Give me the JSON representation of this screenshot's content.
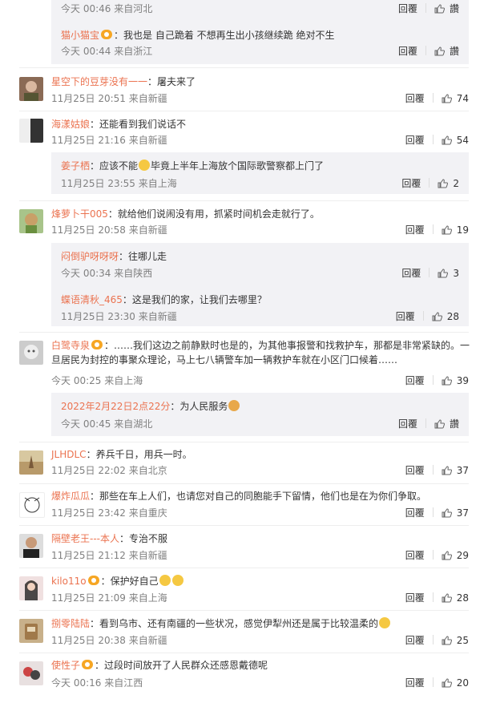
{
  "comments": [
    {
      "meta_top": "今天 00:46 来自河北",
      "reply": "回覆",
      "like": "讚"
    },
    {
      "user": "猫小猫宝",
      "text": "：我也是 自己跪着 不想再生出小孩继续跪 绝对不生",
      "meta": "今天 00:44 来自浙江",
      "reply": "回覆",
      "like": "讚"
    },
    {
      "user": "星空下的豆芽没有一一",
      "text": "：屠夫来了",
      "meta": "11月25日 20:51 来自新疆",
      "reply": "回覆",
      "like": "74"
    },
    {
      "user": "海漾姑娘",
      "text": "：还能看到我们说话不",
      "meta": "11月25日 21:16 来自新疆",
      "reply": "回覆",
      "like": "54"
    },
    {
      "user": "姜子栖",
      "text_a": "：应该不能",
      "text_b": "毕竟上半年上海放个国际歌警察都上门了",
      "meta": "11月25日 23:55 来自上海",
      "reply": "回覆",
      "like": "2"
    },
    {
      "user": "烽萝卜干005",
      "text": "：就给他们说闹没有用，抓紧时间机会走就行了。",
      "meta": "11月25日 20:58 来自新疆",
      "reply": "回覆",
      "like": "19"
    },
    {
      "user": "闷倒驴呀呀呀",
      "text": "：往哪儿走",
      "meta": "今天 00:34 来自陕西",
      "reply": "回覆",
      "like": "3"
    },
    {
      "user": "蝶语清秋_465",
      "text": "：这是我们的家，让我们去哪里？",
      "meta": "11月25日 23:30 来自新疆",
      "reply": "回覆",
      "like": "28"
    },
    {
      "user": "白鹭寺泉",
      "text_1": "：……我们这边之前静默时也是的，为其他事报警和找救护车，那都是非常紧缺的。一",
      "text_2": "旦居民为封控的事聚众理论，马上七八辆警车加一辆救护车就在小区门口候着……",
      "meta": "今天 00:25 来自上海",
      "reply": "回覆",
      "like": "39"
    },
    {
      "user": "2022年2月22日2点22分",
      "text": "：为人民服务",
      "meta": "今天 00:45 来自湖北",
      "reply": "回覆",
      "like": "讚"
    },
    {
      "user": "JLHDLC",
      "text": "：养兵千日，用兵一时。",
      "meta": "11月25日 22:02 来自北京",
      "reply": "回覆",
      "like": "37"
    },
    {
      "user": "爆炸瓜瓜",
      "text": "：那些在车上人们，也请您对自己的同胞能手下留情，他们也是在为你们争取。",
      "meta": "11月25日 23:42 来自重庆",
      "reply": "回覆",
      "like": "37"
    },
    {
      "user": "隔壁老王---本人",
      "text": "：专治不服",
      "meta": "11月25日 21:12 来自新疆",
      "reply": "回覆",
      "like": "29"
    },
    {
      "user": "kilo11o",
      "text": "：保护好自己",
      "meta": "11月25日 21:09 来自上海",
      "reply": "回覆",
      "like": "28"
    },
    {
      "user": "捌零陆陆",
      "text": "：看到乌市、还有南疆的一些状况，感觉伊犁州还是属于比较温柔的",
      "meta": "11月25日 20:38 来自新疆",
      "reply": "回覆",
      "like": "25"
    },
    {
      "user": "使性子",
      "text": "：过段时间放开了人民群众还感恩戴德呢",
      "meta": "今天 00:16 来自江西",
      "reply": "回覆",
      "like": "20"
    }
  ]
}
